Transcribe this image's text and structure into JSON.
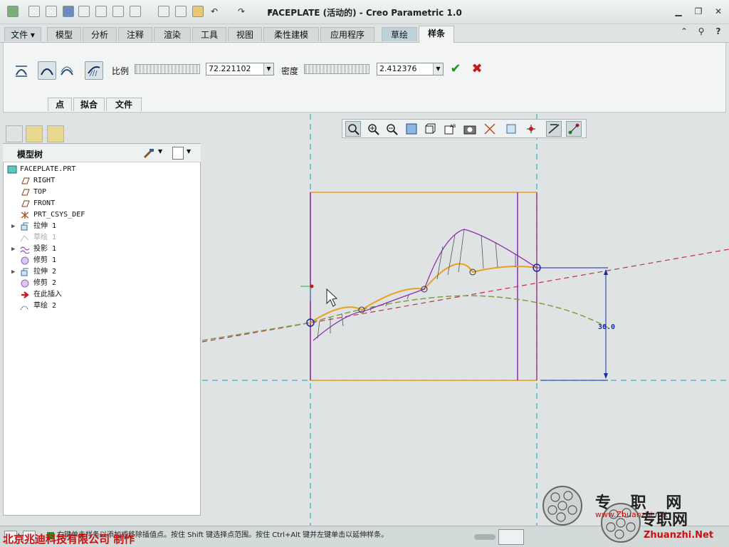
{
  "window": {
    "title": "FACEPLATE (活动的) - Creo Parametric 1.0"
  },
  "ribbon_tabs": [
    {
      "label": "文件 ▾"
    },
    {
      "label": "模型"
    },
    {
      "label": "分析"
    },
    {
      "label": "注释"
    },
    {
      "label": "渲染"
    },
    {
      "label": "工具"
    },
    {
      "label": "视图"
    },
    {
      "label": "柔性建模"
    },
    {
      "label": "应用程序"
    },
    {
      "label": "草绘"
    },
    {
      "label": "样条"
    }
  ],
  "spline_toolbar": {
    "scale_label": "比例",
    "scale_value": "72.221102",
    "density_label": "密度",
    "density_value": "2.412376",
    "ok_symbol": "✔",
    "cancel_symbol": "✖",
    "panels": [
      "点",
      "拟合",
      "文件"
    ]
  },
  "model_tree": {
    "header": "模型树",
    "items": [
      {
        "label": "FACEPLATE.PRT",
        "icon": "part-icon",
        "expandable": false,
        "dimmed": false
      },
      {
        "label": "RIGHT",
        "icon": "datum-plane-icon",
        "expandable": false,
        "dimmed": false
      },
      {
        "label": "TOP",
        "icon": "datum-plane-icon",
        "expandable": false,
        "dimmed": false
      },
      {
        "label": "FRONT",
        "icon": "datum-plane-icon",
        "expandable": false,
        "dimmed": false
      },
      {
        "label": "PRT_CSYS_DEF",
        "icon": "csys-icon",
        "expandable": false,
        "dimmed": false
      },
      {
        "label": "拉伸 1",
        "icon": "extrude-icon",
        "expandable": true,
        "dimmed": false
      },
      {
        "label": "草绘 1",
        "icon": "sketch-icon",
        "expandable": false,
        "dimmed": true
      },
      {
        "label": "投影 1",
        "icon": "projection-icon",
        "expandable": true,
        "dimmed": false
      },
      {
        "label": "修剪 1",
        "icon": "trim-icon",
        "expandable": false,
        "dimmed": false
      },
      {
        "label": "拉伸 2",
        "icon": "extrude-icon",
        "expandable": true,
        "dimmed": false
      },
      {
        "label": "修剪 2",
        "icon": "trim-icon",
        "expandable": false,
        "dimmed": false
      },
      {
        "label": "在此插入",
        "icon": "insert-arrow-icon",
        "expandable": false,
        "dimmed": false
      },
      {
        "label": "草绘 2",
        "icon": "sketch-active-icon",
        "expandable": false,
        "dimmed": false
      }
    ]
  },
  "canvas": {
    "dimension_label": "30.0"
  },
  "status": {
    "message": "右键单击样条以添加或移除插值点。按住 Shift 键选择点范围。按住 Ctrl+Alt 键并左键单击以延伸样条。"
  },
  "watermark": {
    "credit": "北京兆迪科技有限公司  制作",
    "site_cn_top": "专 职 网",
    "site_url_small": "www.Zhuanzhi.net",
    "site_cn": "专职网",
    "site_url": "Zhuanzhi.Net"
  },
  "colors": {
    "sketch_orange": "#e8a020",
    "construction_cyan": "#2ab8c0",
    "purple_edge": "#8a2ab0",
    "dim_blue": "#1a2ab0",
    "centerline_red": "#c03050"
  }
}
